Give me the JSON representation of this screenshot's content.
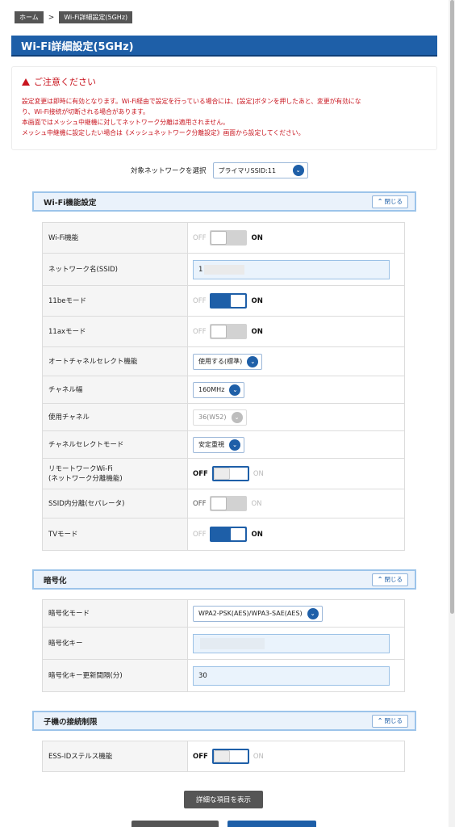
{
  "breadcrumb": {
    "home": "ホーム",
    "sep": ">",
    "current": "Wi-Fi詳細設定(5GHz)"
  },
  "page_title": "Wi-Fi詳細設定(5GHz)",
  "notice": {
    "title": "ご注意ください",
    "lines": [
      "設定変更は即時に有効となります。Wi-Fi経由で設定を行っている場合には、[設定]ボタンを押したあと、変更が有効にな",
      "り、Wi-Fi接続が切断される場合があります。",
      "本画面ではメッシュ中継機に対してネットワーク分離は適用されません。",
      "メッシュ中継機に設定したい場合は《メッシュネットワーク分離設定》画面から設定してください。"
    ]
  },
  "target_network": {
    "label": "対象ネットワークを選択",
    "value": "プライマリSSID:11"
  },
  "close_label": "閉じる",
  "toggle_labels": {
    "off": "OFF",
    "on": "ON"
  },
  "wifi_section": {
    "title": "Wi-Fi機能設定",
    "rows": [
      {
        "label": "Wi-Fi機能",
        "state": "off"
      },
      {
        "label": "ネットワーク名(SSID)",
        "value": "1"
      },
      {
        "label": "11beモード",
        "state": "on"
      },
      {
        "label": "11axモード",
        "state": "off"
      },
      {
        "label": "オートチャネルセレクト機能",
        "value": "使用する(標準)"
      },
      {
        "label": "チャネル幅",
        "value": "160MHz"
      },
      {
        "label": "使用チャネル",
        "value": "36(W52)"
      },
      {
        "label": "チャネルセレクトモード",
        "value": "安定重視"
      },
      {
        "label": "リモートワークWi-Fi",
        "label2": "(ネットワーク分離機能)",
        "state": "off"
      },
      {
        "label": "SSID内分離(セパレータ)",
        "state": "off"
      },
      {
        "label": "TVモード",
        "state": "on"
      }
    ]
  },
  "encryption_section": {
    "title": "暗号化",
    "rows": [
      {
        "label": "暗号化モード",
        "value": "WPA2-PSK(AES)/WPA3-SAE(AES)"
      },
      {
        "label": "暗号化キー",
        "value": ""
      },
      {
        "label": "暗号化キー更新間隔(分)",
        "value": "30"
      }
    ]
  },
  "client_section": {
    "title": "子機の接続制限",
    "rows": [
      {
        "label": "ESS-IDステルス機能",
        "state": "off"
      }
    ]
  },
  "show_details_button": "詳細な項目を表示",
  "colors": {
    "accent": "#1e5fa8",
    "warning": "#c8141e"
  }
}
